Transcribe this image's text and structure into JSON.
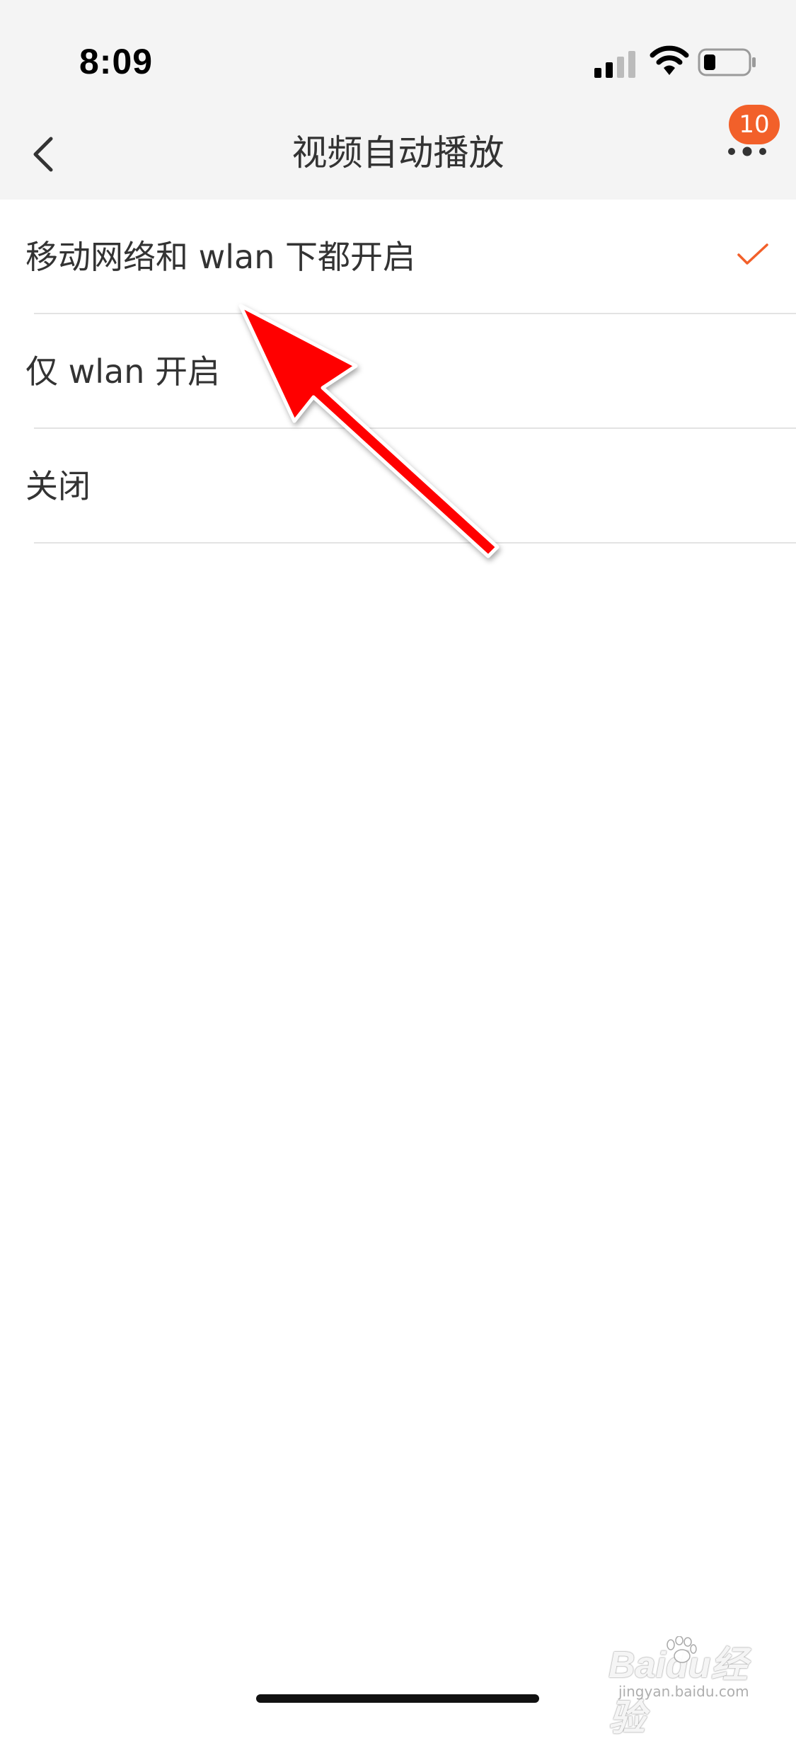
{
  "status_bar": {
    "time": "8:09"
  },
  "nav": {
    "title": "视频自动播放",
    "badge_count": "10"
  },
  "options": [
    {
      "label": "移动网络和 wlan 下都开启",
      "selected": true
    },
    {
      "label": "仅 wlan 开启",
      "selected": false
    },
    {
      "label": "关闭",
      "selected": false
    }
  ],
  "colors": {
    "accent": "#f2602a",
    "arrow": "#ff0000",
    "header_bg": "#f4f4f4"
  },
  "watermark": {
    "logo_text": "Baidu经验",
    "url": "jingyan.baidu.com"
  }
}
